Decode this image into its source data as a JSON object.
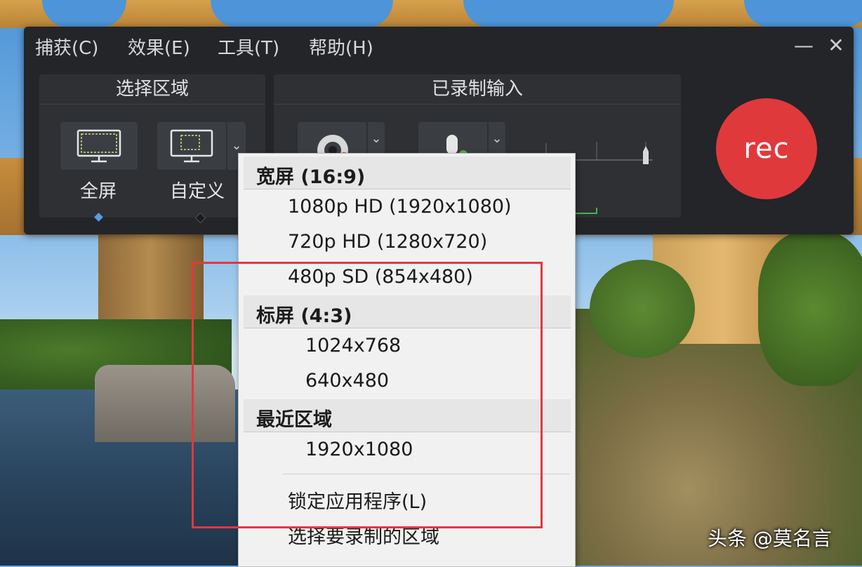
{
  "menubar": {
    "items": [
      "捕获(C)",
      "效果(E)",
      "工具(T)",
      "帮助(H)"
    ],
    "minimize": "—",
    "close": "✕"
  },
  "select_area": {
    "title": "选择区域",
    "fullscreen_label": "全屏",
    "custom_label": "自定义"
  },
  "recorded_input": {
    "title": "已录制输入"
  },
  "rec_button": "rec",
  "dropdown": {
    "widescreen_header": "宽屏 (16:9)",
    "widescreen_items": [
      "1080p HD (1920x1080)",
      "720p HD (1280x720)",
      "480p SD (854x480)"
    ],
    "standard_header": "标屏 (4:3)",
    "standard_items": [
      "1024x768",
      "640x480"
    ],
    "recent_header": "最近区域",
    "recent_items": [
      "1920x1080"
    ],
    "lock_app": "锁定应用程序(L)",
    "select_region": "选择要录制的区域"
  },
  "watermark": "头条 @莫名言",
  "colors": {
    "toolbar_bg": "#232528",
    "panel_bg": "#2e3034",
    "rec_red": "#e0393c",
    "dropdown_bg": "#f1f1f1",
    "highlight": "#e0393c",
    "active_dot": "#5b9be0"
  }
}
